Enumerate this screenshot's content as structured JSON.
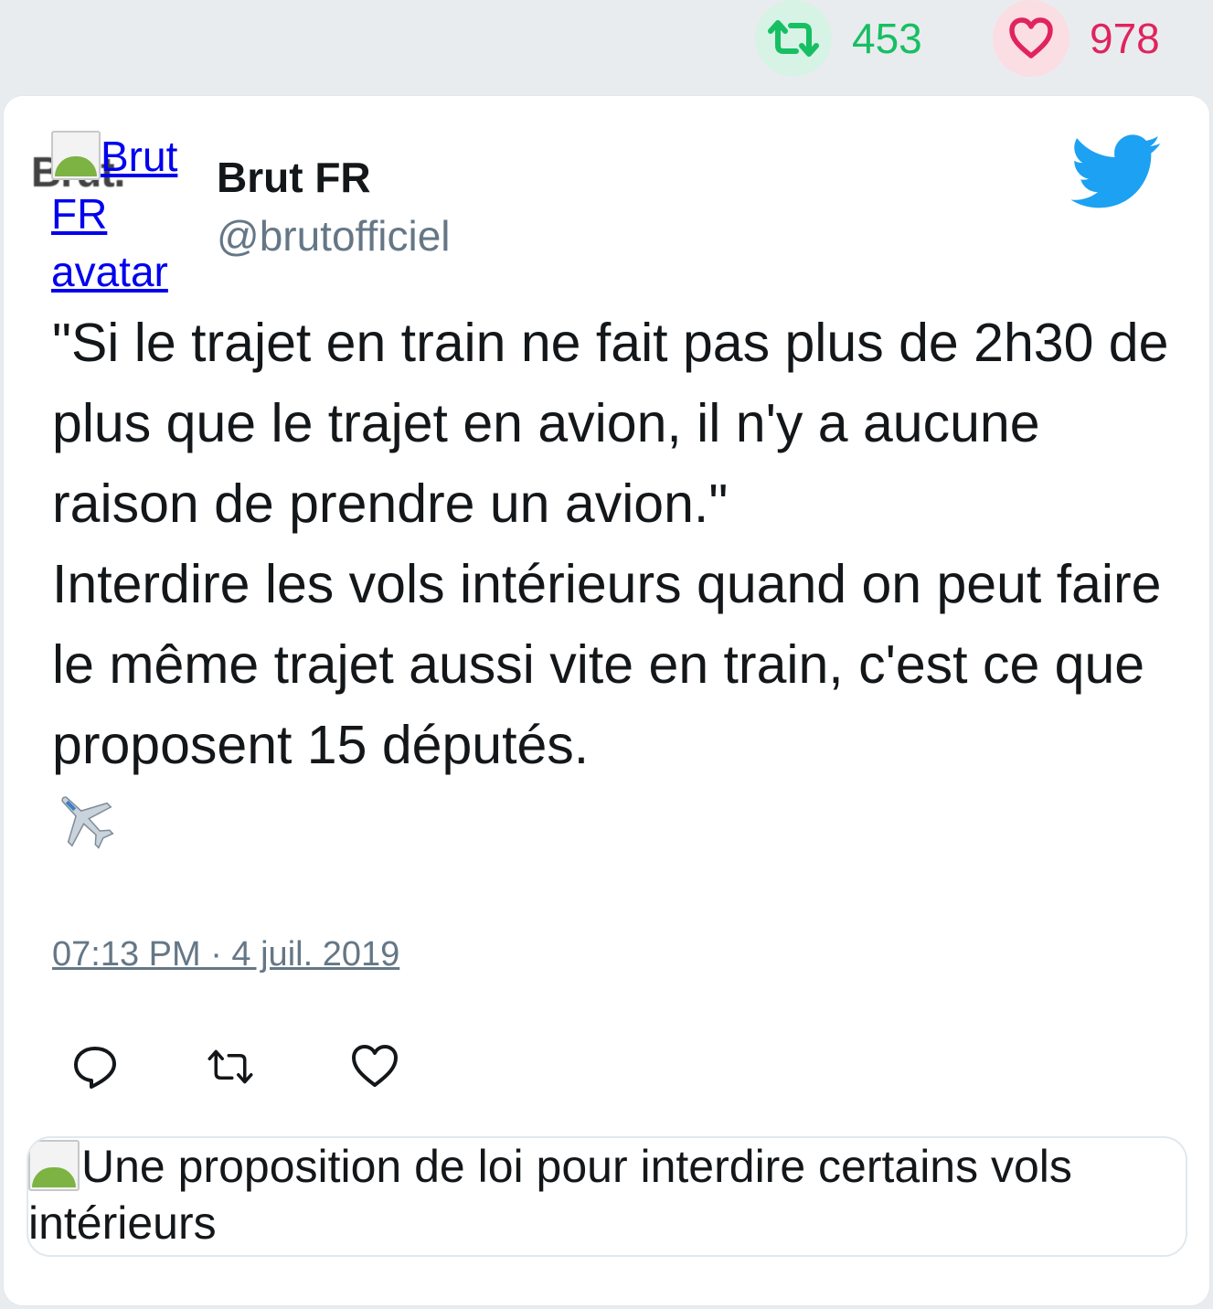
{
  "stats": {
    "retweet_count": "453",
    "like_count": "978"
  },
  "author": {
    "avatar_alt": "Brut FR avatar",
    "avatar_logo": "Brut.",
    "name": "Brut FR",
    "handle": "@brutofficiel"
  },
  "tweet": {
    "text": "\"Si le trajet en train ne fait pas plus de 2h30 de plus que le trajet en avion, il n'y a aucune raison de prendre un avion.\"\nInterdire les vols intérieurs quand on peut faire le même trajet aussi vite en train, c'est ce que proposent 15 députés.",
    "emoji": "airplane-icon",
    "timestamp": "07:13 PM · 4 juil. 2019"
  },
  "link_card": {
    "alt": "Une proposition de loi pour interdire certains vols intérieurs"
  },
  "colors": {
    "retweet": "#17bf63",
    "like": "#e0245e",
    "twitter_blue": "#1da1f2",
    "handle_gray": "#657786"
  }
}
